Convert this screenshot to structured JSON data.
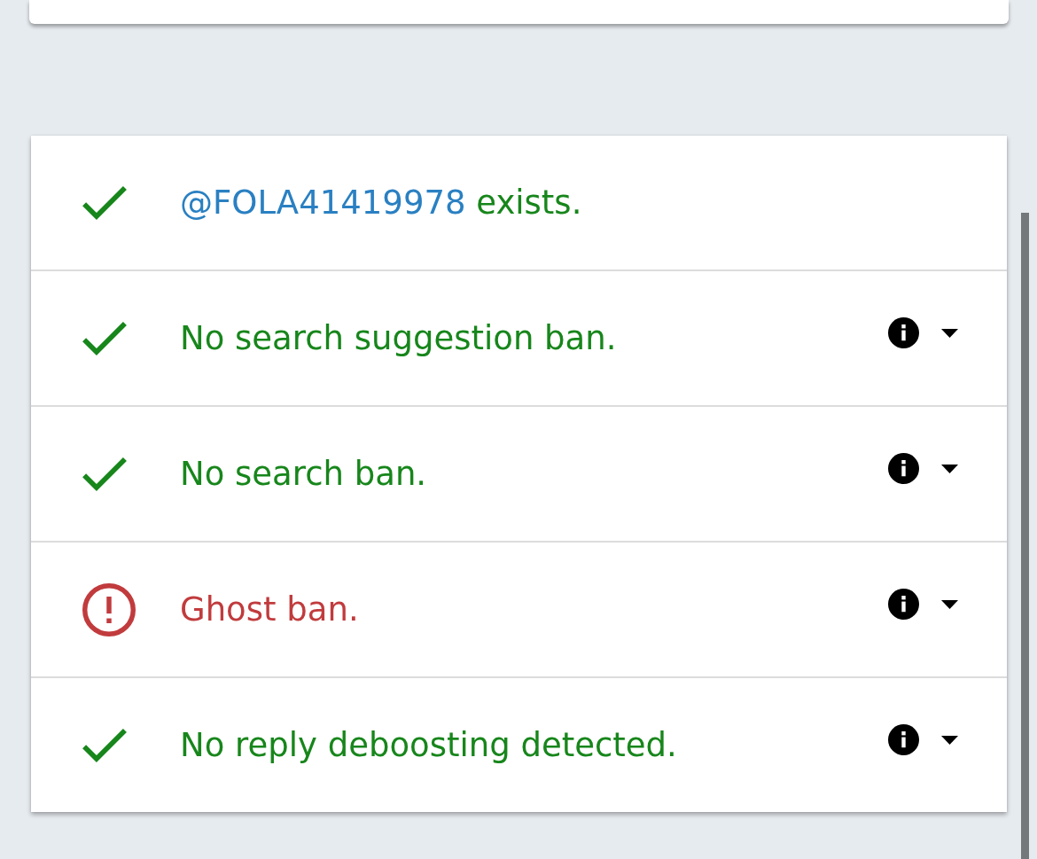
{
  "results": [
    {
      "kind": "ok",
      "handle": "@FOLA41419978",
      "text": "exists.",
      "has_details": false
    },
    {
      "kind": "ok",
      "text": "No search suggestion ban.",
      "has_details": true,
      "expanded": false
    },
    {
      "kind": "ok",
      "text": "No search ban.",
      "has_details": true,
      "expanded": false
    },
    {
      "kind": "warning",
      "text": "Ghost ban.",
      "has_details": true,
      "expanded": false
    },
    {
      "kind": "ok",
      "text": "No reply deboosting detected.",
      "has_details": true,
      "expanded": false
    }
  ]
}
